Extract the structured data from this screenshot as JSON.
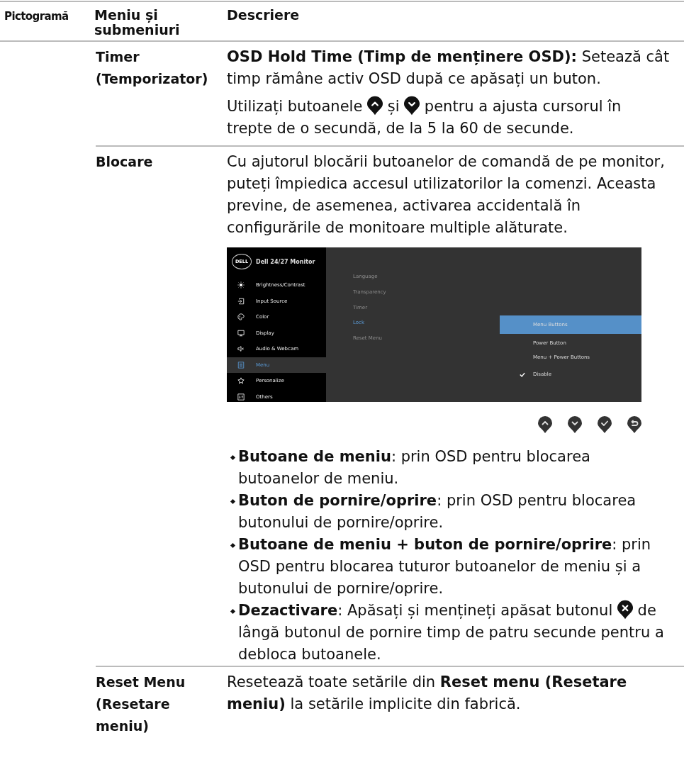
{
  "columns": [
    "Pictogramă",
    "Meniu și submeniuri",
    "Descriere"
  ],
  "rows": [
    {
      "menu": "Timer (Temporizator)",
      "description": [
        {
          "kind": "paragraph",
          "parts": [
            {
              "kind": "text",
              "text": "**OSD Hold Time (Timp de menținere OSD):** Setează cât timp rămâne activ OSD după ce apăsați un buton."
            }
          ]
        },
        {
          "kind": "paragraph",
          "parts": [
            {
              "kind": "text",
              "text": "Utilizați butoanele"
            },
            {
              "kind": "up"
            },
            {
              "kind": "text",
              "text": "și"
            },
            {
              "kind": "down"
            },
            {
              "kind": "text",
              "text": "pentru a ajusta cursorul în"
            },
            {
              "kind": "text",
              "text": "trepte de o secundă, de la 5 la 60 de secunde."
            }
          ]
        }
      ]
    },
    {
      "menu": "Blocare",
      "description": [
        {
          "kind": "paragraph",
          "parts": [
            {
              "kind": "text",
              "text": "Cu ajutorul blocării butoanelor de comandă de pe monitor, puteți împiedica accesul utilizatorilor la comenzi. Aceasta previne, de asemenea, activarea accidentală în configurările de monitoare multiple alăturate."
            }
          ]
        },
        {
          "kind": "osd",
          "logo": "DELL",
          "title": "Dell 24/27 Monitor",
          "menu": [
            {
              "kind": "brightness",
              "label": "Brightness/Contrast",
              "selected": false
            },
            {
              "kind": "input",
              "label": "Input Source",
              "selected": false
            },
            {
              "kind": "color",
              "label": "Color",
              "selected": false
            },
            {
              "kind": "display",
              "label": "Display",
              "selected": false
            },
            {
              "kind": "audio",
              "label": "Audio & Webcam",
              "selected": false
            },
            {
              "kind": "menu",
              "label": "Menu",
              "selected": true
            },
            {
              "kind": "star",
              "label": "Personalize",
              "selected": false
            },
            {
              "kind": "others",
              "label": "Others",
              "selected": false
            }
          ],
          "submenu": [
            {
              "label": "Language",
              "selected": false
            },
            {
              "label": "Transparency",
              "selected": false
            },
            {
              "label": "Timer",
              "selected": false
            },
            {
              "label": "Lock",
              "selected": true
            },
            {
              "label": "Reset Menu",
              "selected": false
            }
          ],
          "options": [
            {
              "label": "Menu Buttons",
              "selected": true,
              "checked": false
            },
            {
              "label": "Power Button",
              "selected": false,
              "checked": false
            },
            {
              "label": "Menu + Power Buttons",
              "selected": false,
              "checked": false
            },
            {
              "label": "Disable",
              "selected": false,
              "checked": true
            }
          ]
        },
        {
          "kind": "buttons",
          "icons": [
            {
              "kind": "up"
            },
            {
              "kind": "down"
            },
            {
              "kind": "check"
            },
            {
              "kind": "back"
            }
          ]
        },
        {
          "kind": "bullets",
          "items": [
            [
              {
                "kind": "text",
                "text": "**Butoane de meniu**: prin OSD pentru blocarea butoanelor de meniu."
              }
            ],
            [
              {
                "kind": "text",
                "text": "**Buton de pornire/oprire**: prin OSD pentru blocarea butonului de pornire/oprire."
              }
            ],
            [
              {
                "kind": "text",
                "text": "**Butoane de meniu + buton de pornire/oprire**: prin OSD pentru blocarea tuturor butoanelor de meniu și a butonului de pornire/oprire."
              }
            ],
            [
              {
                "kind": "text",
                "text": "**Dezactivare**: Apăsați și mențineți apăsat butonul"
              },
              {
                "kind": "close"
              },
              {
                "kind": "text",
                "text": "de"
              },
              {
                "kind": "text",
                "text": "lângă butonul de pornire timp de patru secunde pentru a"
              },
              {
                "kind": "text",
                "text": "debloca butoanele."
              }
            ]
          ]
        }
      ]
    },
    {
      "menu": "Reset Menu (Resetare meniu)",
      "description": [
        {
          "kind": "paragraph",
          "parts": [
            {
              "kind": "text",
              "text": "Resetează toate setările din **Reset menu (Resetare meniu)** la setările implicite din fabrică."
            }
          ]
        }
      ]
    }
  ]
}
